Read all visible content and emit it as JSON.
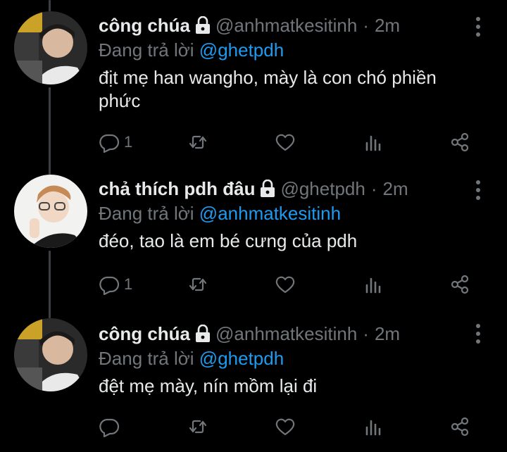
{
  "tweets": [
    {
      "display_name": "công chúa",
      "handle": "@anhmatkesitinh",
      "separator": "·",
      "time": "2m",
      "reply_prefix": "Đang trả lời",
      "reply_to": "@ghetpdh",
      "text": "địt mẹ han wangho, mày là con chó phiền phức",
      "reply_count": "1"
    },
    {
      "display_name": "chả thích pdh đâu",
      "handle": "@ghetpdh",
      "separator": "·",
      "time": "2m",
      "reply_prefix": "Đang trả lời",
      "reply_to": "@anhmatkesitinh",
      "text": "đéo, tao là em bé cưng của pdh",
      "reply_count": "1"
    },
    {
      "display_name": "công chúa",
      "handle": "@anhmatkesitinh",
      "separator": "·",
      "time": "2m",
      "reply_prefix": "Đang trả lời",
      "reply_to": "@ghetpdh",
      "text": "đệt mẹ mày, nín mồm lại đi",
      "reply_count": ""
    }
  ],
  "icons": {
    "lock": "lock-icon",
    "more": "more-vertical-icon",
    "reply": "comment-icon",
    "retweet": "retweet-icon",
    "like": "heart-icon",
    "views": "analytics-icon",
    "share": "share-icon"
  },
  "colors": {
    "background": "#000000",
    "text": "#e7e9ea",
    "muted": "#71767b",
    "link": "#1d9bf0",
    "thread_line": "#3b3f44"
  }
}
